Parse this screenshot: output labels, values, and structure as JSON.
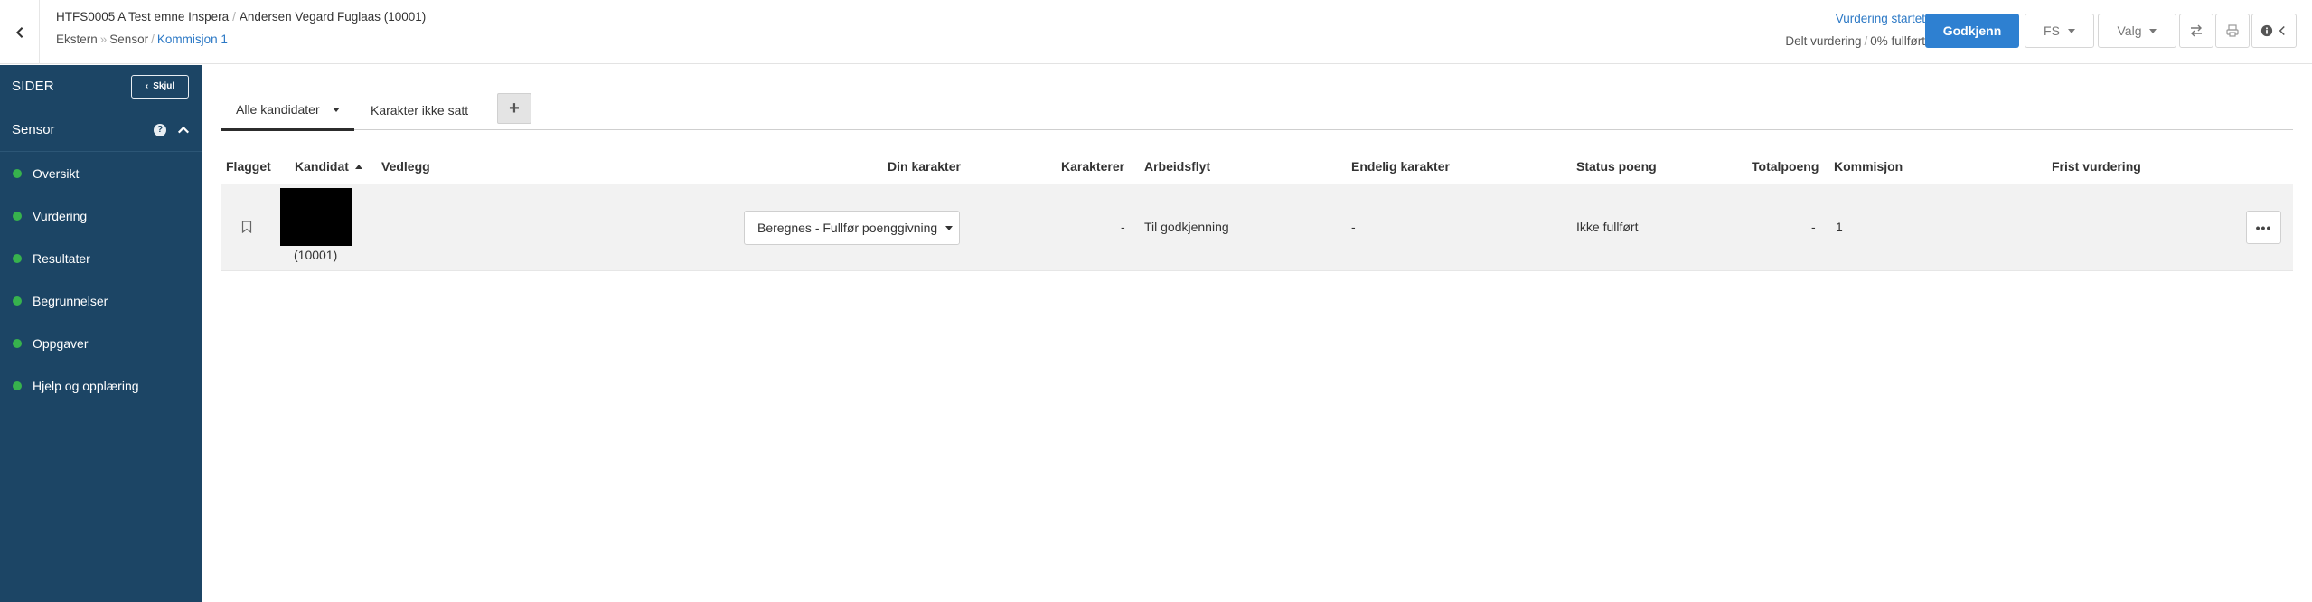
{
  "header": {
    "course": "HTFS0005 A Test emne Inspera",
    "candidate_name": "Andersen Vegard Fuglaas (10001)",
    "breadcrumb": [
      "Ekstern",
      "Sensor",
      "Kommisjon 1"
    ],
    "status_link": "Vurdering startet",
    "shared_label": "Delt vurdering",
    "progress_label": "0% fullført",
    "approve_label": "Godkjenn",
    "fs_label": "FS",
    "choose_label": "Valg"
  },
  "sidebar": {
    "title": "SIDER",
    "hide_label": "Skjul",
    "section": "Sensor",
    "items": [
      {
        "label": "Oversikt"
      },
      {
        "label": "Vurdering"
      },
      {
        "label": "Resultater"
      },
      {
        "label": "Begrunnelser"
      },
      {
        "label": "Oppgaver"
      },
      {
        "label": "Hjelp og opplæring"
      }
    ]
  },
  "tabs": [
    {
      "label": "Alle kandidater",
      "active": true
    },
    {
      "label": "Karakter ikke satt",
      "active": false
    }
  ],
  "table": {
    "columns": [
      "Flagget",
      "Kandidat",
      "Vedlegg",
      "Din karakter",
      "Karakterer",
      "Arbeidsflyt",
      "Endelig karakter",
      "Status poeng",
      "Totalpoeng",
      "Kommisjon",
      "Frist vurdering"
    ],
    "rows": [
      {
        "candidate_id": "(10001)",
        "din_karakter": "Beregnes - Fullfør poenggivning",
        "karakterer": "-",
        "arbeidsflyt": "Til godkjenning",
        "endelig_karakter": "-",
        "status_poeng": "Ikke fullført",
        "totalpoeng": "-",
        "kommisjon": "1",
        "frist": ""
      }
    ]
  },
  "colors": {
    "sidebar_bg": "#1c4565",
    "primary": "#2e80d1",
    "link": "#2b78c5",
    "status_dot": "#37b24d",
    "row_bg": "#f2f2f2"
  }
}
